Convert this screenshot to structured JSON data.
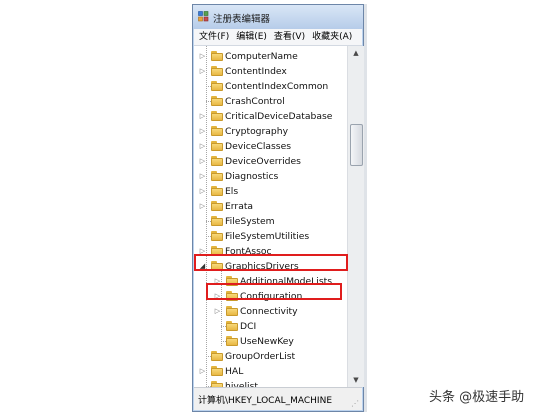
{
  "window": {
    "title": "注册表编辑器",
    "menu": [
      "文件(F)",
      "编辑(E)",
      "查看(V)",
      "收藏夹(A)"
    ],
    "status": "计算机\\HKEY_LOCAL_MACHINE"
  },
  "tree": {
    "items": [
      {
        "label": "ComputerName",
        "level": 1,
        "expander": "collapsed"
      },
      {
        "label": "ContentIndex",
        "level": 1,
        "expander": "collapsed"
      },
      {
        "label": "ContentIndexCommon",
        "level": 1,
        "expander": "none"
      },
      {
        "label": "CrashControl",
        "level": 1,
        "expander": "none"
      },
      {
        "label": "CriticalDeviceDatabase",
        "level": 1,
        "expander": "collapsed"
      },
      {
        "label": "Cryptography",
        "level": 1,
        "expander": "collapsed"
      },
      {
        "label": "DeviceClasses",
        "level": 1,
        "expander": "collapsed"
      },
      {
        "label": "DeviceOverrides",
        "level": 1,
        "expander": "collapsed"
      },
      {
        "label": "Diagnostics",
        "level": 1,
        "expander": "collapsed"
      },
      {
        "label": "Els",
        "level": 1,
        "expander": "collapsed"
      },
      {
        "label": "Errata",
        "level": 1,
        "expander": "collapsed"
      },
      {
        "label": "FileSystem",
        "level": 1,
        "expander": "none"
      },
      {
        "label": "FileSystemUtilities",
        "level": 1,
        "expander": "none"
      },
      {
        "label": "FontAssoc",
        "level": 1,
        "expander": "collapsed"
      },
      {
        "label": "GraphicsDrivers",
        "level": 1,
        "expander": "expanded"
      },
      {
        "label": "AdditionalModeLists",
        "level": 2,
        "expander": "collapsed"
      },
      {
        "label": "Configuration",
        "level": 2,
        "expander": "collapsed"
      },
      {
        "label": "Connectivity",
        "level": 2,
        "expander": "collapsed"
      },
      {
        "label": "DCI",
        "level": 2,
        "expander": "none"
      },
      {
        "label": "UseNewKey",
        "level": 2,
        "expander": "none"
      },
      {
        "label": "GroupOrderList",
        "level": 1,
        "expander": "none"
      },
      {
        "label": "HAL",
        "level": 1,
        "expander": "collapsed"
      },
      {
        "label": "hivelist",
        "level": 1,
        "expander": "none"
      }
    ]
  },
  "colors": {
    "highlight": "#e01d1d",
    "folder": "#f2c85b",
    "titlebar": "#bcd3ee"
  },
  "watermark": "头条 @极速手助"
}
